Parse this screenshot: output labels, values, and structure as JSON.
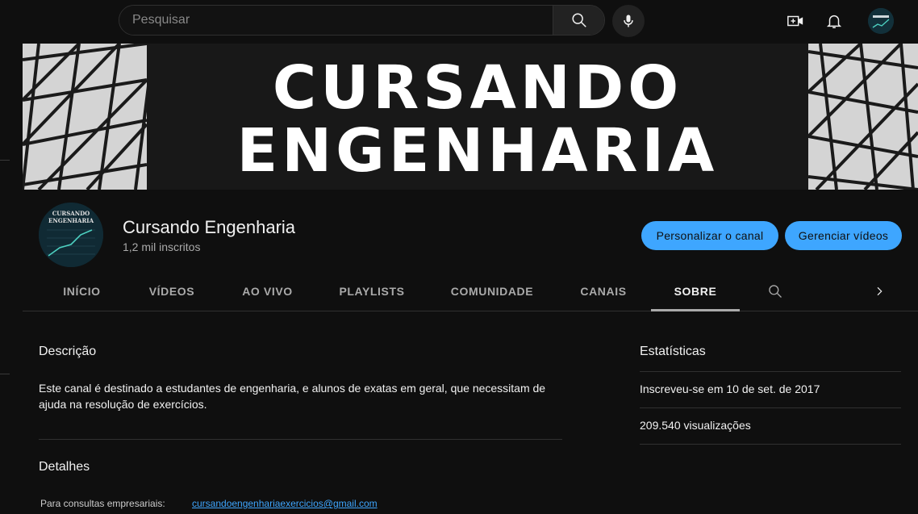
{
  "search": {
    "placeholder": "Pesquisar"
  },
  "header_icons": [
    "search-icon",
    "mic-icon",
    "create-video-icon",
    "bell-icon",
    "account-avatar"
  ],
  "banner": {
    "line1": "CURSANDO",
    "line2": "ENGENHARIA"
  },
  "avatar_text": {
    "line1": "CURSANDO",
    "line2": "ENGENHARIA"
  },
  "channel": {
    "name": "Cursando Engenharia",
    "subscribers": "1,2 mil inscritos",
    "customize_label": "Personalizar o canal",
    "manage_label": "Gerenciar vídeos"
  },
  "tabs": [
    {
      "label": "INÍCIO"
    },
    {
      "label": "VÍDEOS"
    },
    {
      "label": "AO VIVO"
    },
    {
      "label": "PLAYLISTS"
    },
    {
      "label": "COMUNIDADE"
    },
    {
      "label": "CANAIS"
    },
    {
      "label": "SOBRE",
      "active": true
    }
  ],
  "about": {
    "description_title": "Descrição",
    "description": "Este canal é destinado a estudantes de engenharia, e alunos de exatas em geral, que necessitam de ajuda na resolução de exercícios.",
    "details_title": "Detalhes",
    "business_label": "Para consultas empresariais:",
    "business_email": "cursandoengenhariaexercicios@gmail.com"
  },
  "stats": {
    "title": "Estatísticas",
    "joined": "Inscreveu-se em 10 de set. de 2017",
    "views": "209.540 visualizações"
  },
  "colors": {
    "accent": "#3ea6ff",
    "background": "#0f0f0f",
    "divider": "#303030"
  }
}
